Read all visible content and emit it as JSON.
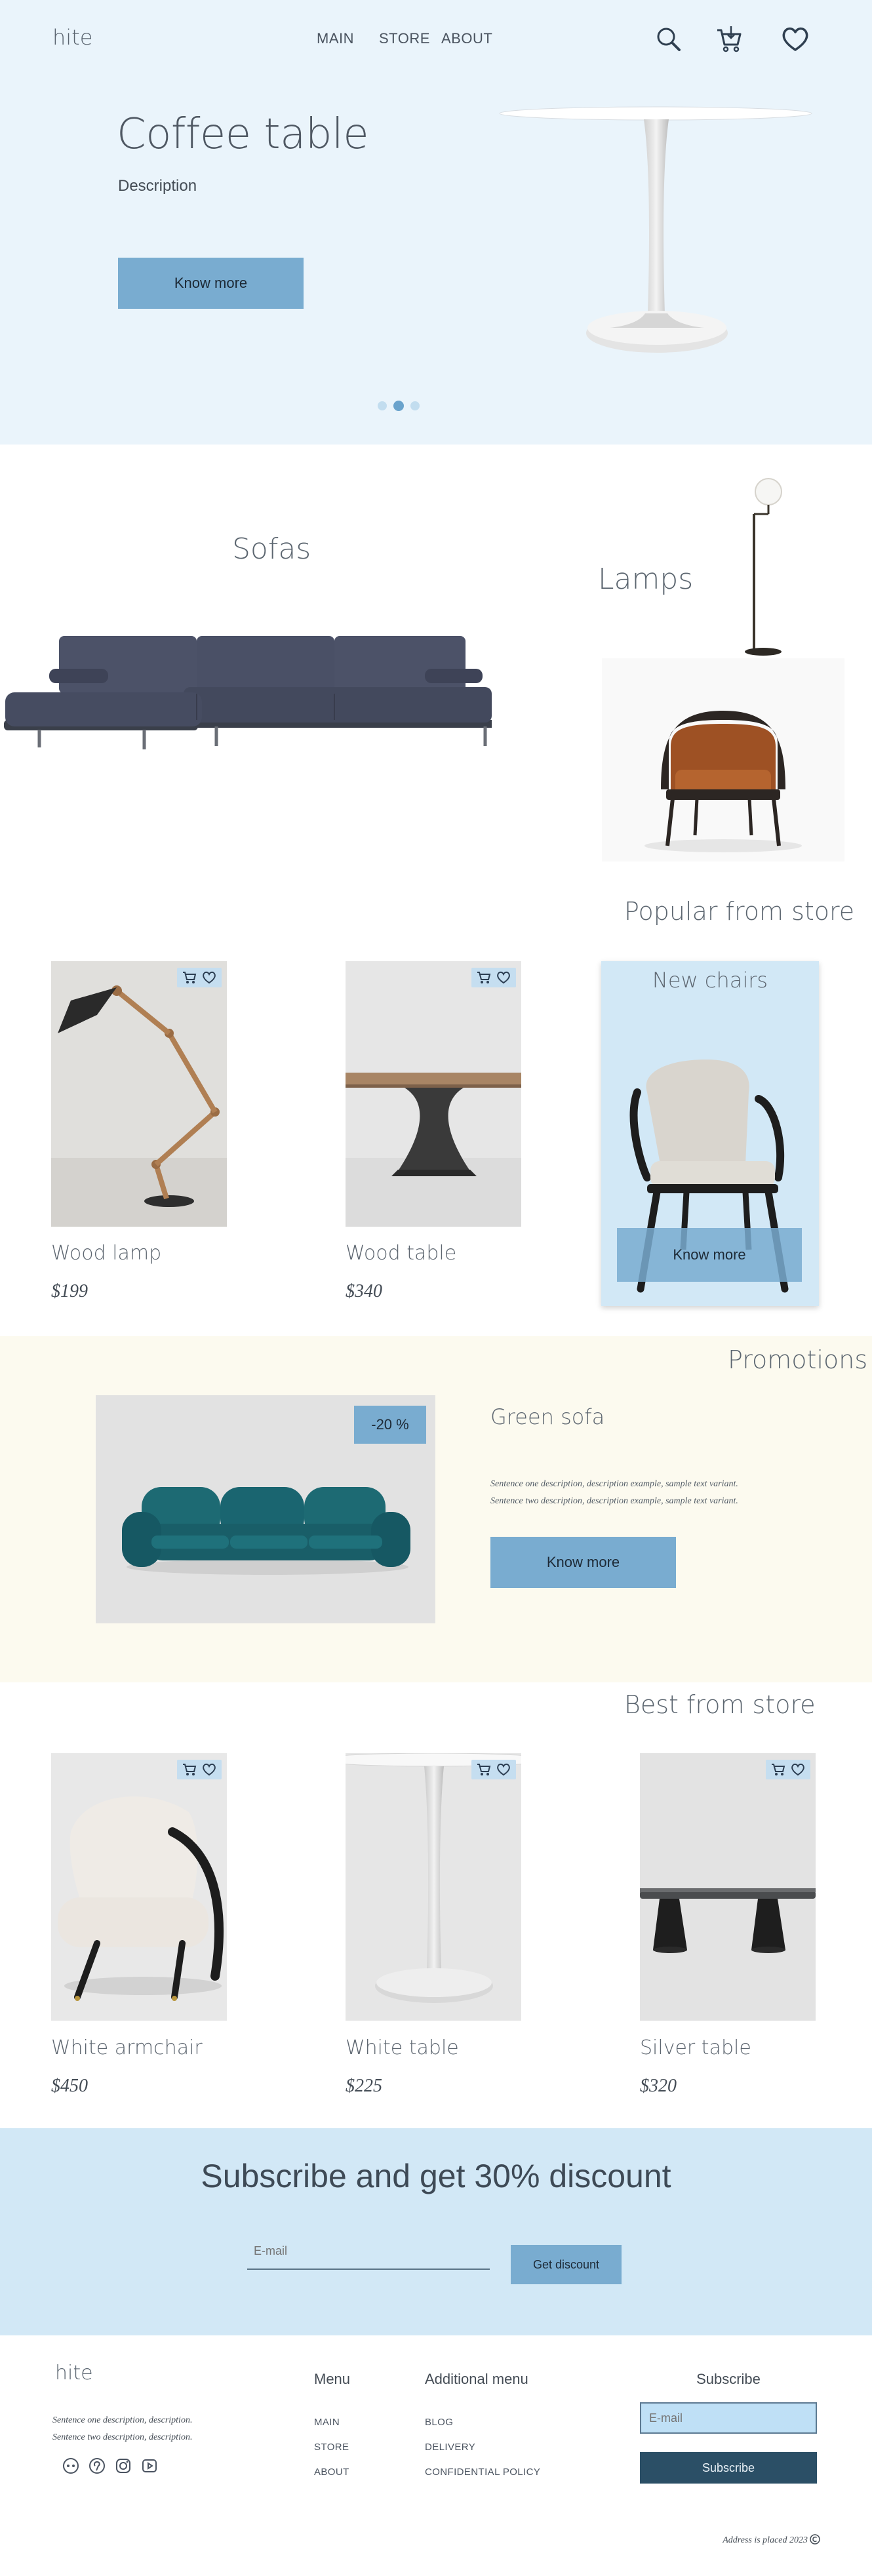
{
  "header": {
    "logo": "hite",
    "nav": [
      "MAIN",
      "STORE",
      "ABOUT"
    ]
  },
  "hero": {
    "title": "Coffee table",
    "subtitle": "Description",
    "button": "Know more",
    "slides": 3,
    "active_slide": 2
  },
  "categories": {
    "sofas": "Sofas",
    "lamps": "Lamps"
  },
  "popular": {
    "heading": "Popular from store",
    "products": [
      {
        "name": "Wood lamp",
        "price": "$199"
      },
      {
        "name": "Wood table",
        "price": "$340"
      }
    ],
    "promo_card": {
      "title": "New chairs",
      "button": "Know more"
    }
  },
  "promotions": {
    "heading": "Promotions",
    "badge": "-20 %",
    "product": "Green sofa",
    "desc1": "Sentence one description, description example, sample text  variant.",
    "desc2": "Sentence two description, description example, sample text  variant.",
    "button": "Know more"
  },
  "best": {
    "heading": "Best from store",
    "products": [
      {
        "name": "White armchair",
        "price": "$450"
      },
      {
        "name": "White table",
        "price": "$225"
      },
      {
        "name": "Silver table",
        "price": "$320"
      }
    ]
  },
  "subscribe": {
    "title": "Subscribe and get 30% discount",
    "placeholder": "E-mail",
    "button": "Get discount"
  },
  "footer": {
    "logo": "hite",
    "desc1": "Sentence one description, description.",
    "desc2": "Sentence two description, description.",
    "menu_title": "Menu",
    "menu": [
      "MAIN",
      "STORE",
      "ABOUT"
    ],
    "additional_title": "Additional menu",
    "additional": [
      "BLOG",
      "DELIVERY",
      "CONFIDENTIAL POLICY"
    ],
    "subscribe_title": "Subscribe",
    "email_placeholder": "E-mail",
    "subscribe_button": "Subscribe",
    "address": "Address is placed 2023"
  },
  "colors": {
    "hero_bg": "#eaf4fb",
    "accent": "#79acd0",
    "promo_bg": "#fcfaef",
    "subscribe_bg": "#d2e8f6",
    "dark_button": "#2b4f66"
  }
}
